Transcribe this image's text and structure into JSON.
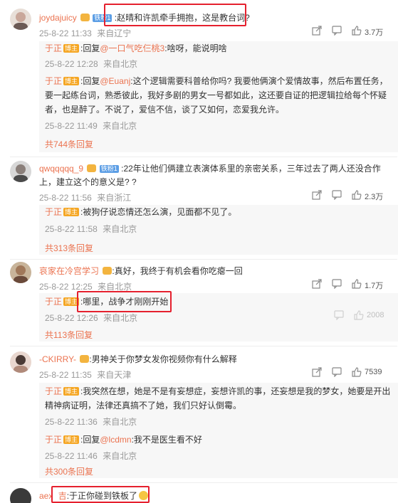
{
  "colors": {
    "name": "#eb7350",
    "meta": "#999999",
    "highlight": "#e5202e",
    "reply_bg": "#f7f7f7"
  },
  "comments": [
    {
      "user": "joydajuicy",
      "badge": "铁粉1",
      "text": ":赵晴和许凯牵手拥抱，这是教台词?",
      "date": "25-8-22 11:33",
      "location": "来自辽宁",
      "likes": "3.7万",
      "replies": [
        {
          "user": "于正",
          "tag": "博主",
          "prefix": ":回复",
          "at": "@一口气吃仨桃3",
          "text": ":啥呀，能说明啥",
          "date": "25-8-22 12:28",
          "location": "来自北京"
        },
        {
          "user": "于正",
          "tag": "博主",
          "prefix": ":回复",
          "at": "@Euanj",
          "text": ":这个逻辑需要科普给你吗? 我要他俩演个爱情故事，然后布置任务，要一起练台词，熟悉彼此，我好多剧的男女一号都如此，这还要自证的把逻辑拉给每个怀疑者，也是醉了。不说了，爱信不信，谈了又如何，恋爱我允许。",
          "date": "25-8-22 11:49",
          "location": "来自北京"
        }
      ],
      "more": "共744条回复"
    },
    {
      "user": "qwqqqqq_9",
      "badge": "铁粉1",
      "text": ":22年让他们俩建立表演体系里的亲密关系，三年过去了两人还没合作上，建立这个的意义是? ?",
      "date": "25-8-22 11:56",
      "location": "来自浙江",
      "likes": "2.3万",
      "replies": [
        {
          "user": "于正",
          "tag": "博主",
          "text": ":被狗仔说恋情还怎么演，见面都不见了。",
          "date": "25-8-22 11:58",
          "location": "来自北京"
        }
      ],
      "more": "共313条回复"
    },
    {
      "user": "哀家在冷宫学习",
      "badge": "",
      "text": ":真好，我终于有机会看你吃瘪一回",
      "date": "25-8-22 12:25",
      "location": "来自北京",
      "likes": "1.7万",
      "replies": [
        {
          "user": "于正",
          "tag": "博主",
          "text": ":哪里，战争才刚刚开始",
          "date": "25-8-22 12:26",
          "location": "来自北京",
          "likes": "2008"
        }
      ],
      "more": "共113条回复"
    },
    {
      "user": "-CKIRRY-",
      "badge": "",
      "text": ":男神关于你梦女发你视频你有什么解释",
      "date": "25-8-22 11:35",
      "location": "来自天津",
      "likes": "7539",
      "replies": [
        {
          "user": "于正",
          "tag": "博主",
          "text": ":我突然在想，她是不是有妄想症，妄想许凯的事，还妄想是我的梦女，她要是开出精神病证明，法律还真搞不了她，我们只好认倒霉。",
          "date": "25-8-22 11:36",
          "location": "来自北京"
        },
        {
          "user": "于正",
          "tag": "博主",
          "prefix": ":回复",
          "at": "@lcdmn",
          "text": ":我不是医生看不好",
          "date": "25-8-22 11:46",
          "location": "来自北京"
        }
      ],
      "more": "共300条回复"
    },
    {
      "user": "aex",
      "badge": "",
      "user2": "吉",
      "text": ":于正你碰到铁板了"
    }
  ]
}
